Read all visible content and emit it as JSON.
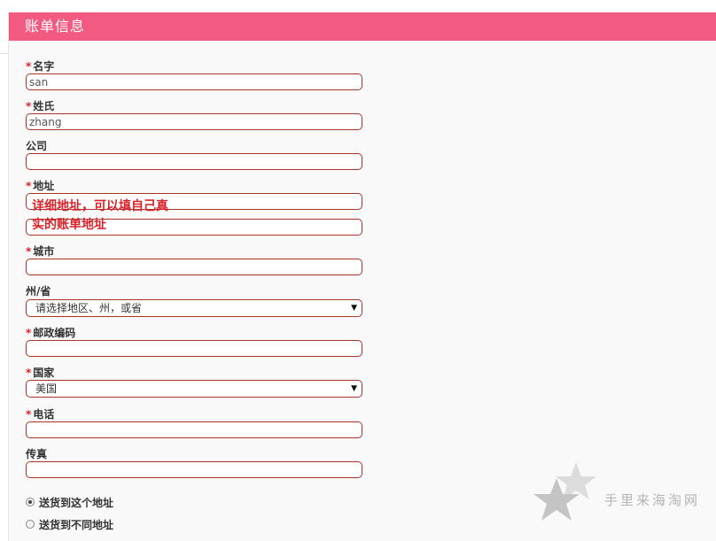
{
  "section": {
    "title": "账单信息"
  },
  "required_mark": "*",
  "fields": {
    "first_name": {
      "label": "名字",
      "value": "san"
    },
    "last_name": {
      "label": "姓氏",
      "value": "zhang"
    },
    "company": {
      "label": "公司",
      "value": ""
    },
    "address": {
      "label": "地址",
      "value_line1": "",
      "value_line2": ""
    },
    "city": {
      "label": "城市",
      "value": ""
    },
    "state": {
      "label": "州/省",
      "selected": "请选择地区、州，或省"
    },
    "postcode": {
      "label": "邮政编码",
      "value": ""
    },
    "country": {
      "label": "国家",
      "selected": "美国"
    },
    "phone": {
      "label": "电话",
      "value": ""
    },
    "fax": {
      "label": "传真",
      "value": ""
    }
  },
  "annotation": {
    "text": "详细地址，可以填自己真实的账单地址",
    "color": "#d8232a"
  },
  "shipping": {
    "option_same": "送货到这个地址",
    "option_different": "送货到不同地址",
    "selected": "same"
  },
  "watermark": {
    "text": "手里来海淘网"
  },
  "colors": {
    "header": "#f25a82",
    "input_border": "#a8332b",
    "required": "#e0202a"
  }
}
